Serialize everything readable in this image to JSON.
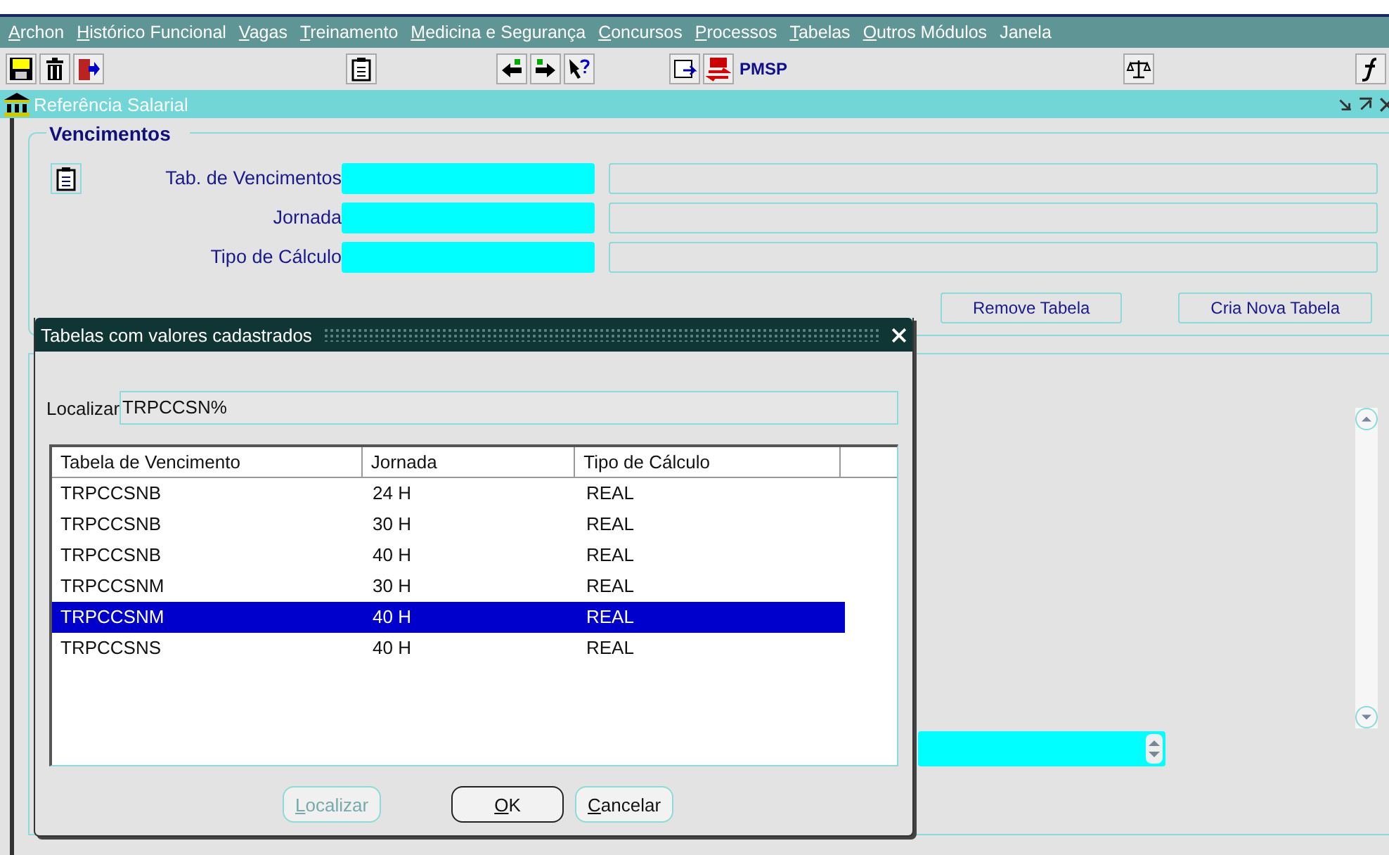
{
  "menu": [
    {
      "label": "Archon",
      "mnemonic": true
    },
    {
      "label": "Histórico Funcional",
      "mnemonic": true
    },
    {
      "label": "Vagas",
      "mnemonic": true
    },
    {
      "label": "Treinamento",
      "mnemonic": true
    },
    {
      "label": "Medicina e Segurança",
      "mnemonic": true
    },
    {
      "label": "Concursos",
      "mnemonic": true
    },
    {
      "label": "Processos",
      "mnemonic": true
    },
    {
      "label": "Tabelas",
      "mnemonic": true
    },
    {
      "label": "Outros Módulos",
      "mnemonic": true
    },
    {
      "label": "Janela",
      "mnemonic": false
    }
  ],
  "toolbar": {
    "brand": "PMSP"
  },
  "window": {
    "title": "Referência Salarial"
  },
  "vencimentos": {
    "title": "Vencimentos",
    "fields": [
      {
        "label": "Tab. de Vencimentos"
      },
      {
        "label": "Jornada"
      },
      {
        "label": "Tipo de Cálculo"
      }
    ],
    "buttons": [
      {
        "label": "Remove Tabela"
      },
      {
        "label": "Cria Nova Tabela"
      }
    ]
  },
  "dialog": {
    "title": "Tabelas com valores cadastrados",
    "search_label": "Localizar",
    "search_value": "TRPCCSN%",
    "columns": [
      "Tabela de Vencimento",
      "Jornada",
      "Tipo de Cálculo"
    ],
    "rows": [
      {
        "cells": [
          "TRPCCSNB",
          "24 H",
          "REAL"
        ],
        "selected": false
      },
      {
        "cells": [
          "TRPCCSNB",
          "30 H",
          "REAL"
        ],
        "selected": false
      },
      {
        "cells": [
          "TRPCCSNB",
          "40 H",
          "REAL"
        ],
        "selected": false
      },
      {
        "cells": [
          "TRPCCSNM",
          "30 H",
          "REAL"
        ],
        "selected": false
      },
      {
        "cells": [
          "TRPCCSNM",
          "40 H",
          "REAL"
        ],
        "selected": true
      },
      {
        "cells": [
          "TRPCCSNS",
          "40 H",
          "REAL"
        ],
        "selected": false
      }
    ],
    "buttons": [
      {
        "label": "Localizar",
        "disabled": true,
        "default": false
      },
      {
        "label": "OK",
        "disabled": false,
        "default": true
      },
      {
        "label": "Cancelar",
        "disabled": false,
        "default": false
      }
    ]
  }
}
